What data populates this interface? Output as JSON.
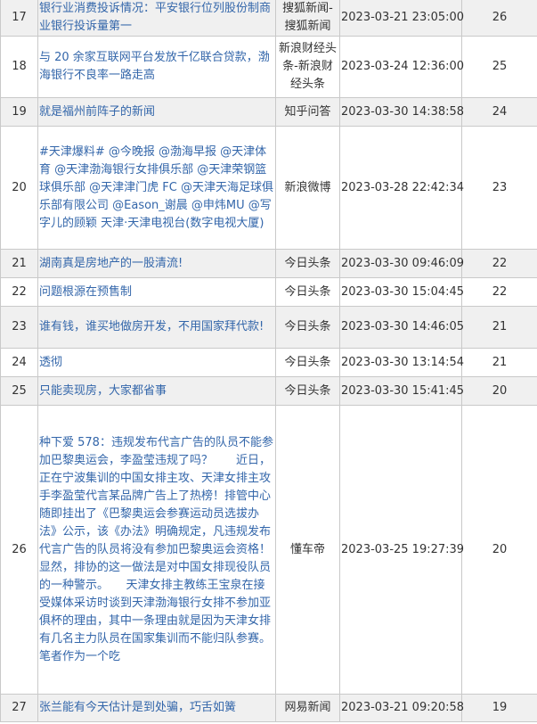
{
  "rows": [
    {
      "idx": "17",
      "title": "银行业消费投诉情况：平安银行位列股份制商业银行投诉量第一",
      "source": "搜狐新闻-搜狐新闻",
      "time": "2023-03-21 23:05:00",
      "count": "26"
    },
    {
      "idx": "18",
      "title": "与 20 余家互联网平台发放千亿联合贷款，渤海银行不良率一路走高",
      "source": "新浪财经头条-新浪财经头条",
      "time": "2023-03-24 12:36:00",
      "count": "25"
    },
    {
      "idx": "19",
      "title": "就是福州前阵子的新闻",
      "source": "知乎问答",
      "time": "2023-03-30 14:38:58",
      "count": "24"
    },
    {
      "idx": "20",
      "title": "#天津爆料# @今晚报 @渤海早报 @天津体育 @天津渤海银行女排俱乐部 @天津荣钢篮球俱乐部 @天津津门虎 FC @天津天海足球俱乐部有限公司 @Eason_谢晨 @申炜MU @写字儿的顾颖 天津·天津电视台(数字电视大厦)",
      "source": "新浪微博",
      "time": "2023-03-28 22:42:34",
      "count": "23"
    },
    {
      "idx": "21",
      "title": "湖南真是房地产的一股清流!",
      "source": "今日头条",
      "time": "2023-03-30 09:46:09",
      "count": "22"
    },
    {
      "idx": "22",
      "title": "问题根源在预售制",
      "source": "今日头条",
      "time": "2023-03-30 15:04:45",
      "count": "22"
    },
    {
      "idx": "23",
      "title": "谁有钱，谁买地做房开发，不用国家拜代款!",
      "source": "今日头条",
      "time": "2023-03-30 14:46:05",
      "count": "21"
    },
    {
      "idx": "24",
      "title": "透彻",
      "source": "今日头条",
      "time": "2023-03-30 13:14:54",
      "count": "21"
    },
    {
      "idx": "25",
      "title": "只能卖现房，大家都省事",
      "source": "今日头条",
      "time": "2023-03-30 15:41:45",
      "count": "20"
    },
    {
      "idx": "26",
      "title": "种下爱 578：违规发布代言广告的队员不能参加巴黎奥运会，李盈莹违规了吗？　　近日，正在宁波集训的中国女排主攻、天津女排主攻手李盈莹代言某品牌广告上了热榜！排管中心随即挂出了《巴黎奥运会参赛运动员选拔办法》公示，该《办法》明确规定，凡违规发布代言广告的队员将没有参加巴黎奥运会资格！显然，排协的这一做法是对中国女排现役队员的一种警示。　　天津女排主教练王宝泉在接受媒体采访时谈到天津渤海银行女排不参加亚俱杯的理由，其中一条理由就是因为天津女排有几名主力队员在国家集训而不能归队参赛。　　笔者作为一个吃",
      "source": "懂车帝",
      "time": "2023-03-25 19:27:39",
      "count": "20"
    },
    {
      "idx": "27",
      "title": "张兰能有今天估计是到处骗，巧舌如簧",
      "source": "网易新闻",
      "time": "2023-03-21 09:20:58",
      "count": "19"
    }
  ]
}
